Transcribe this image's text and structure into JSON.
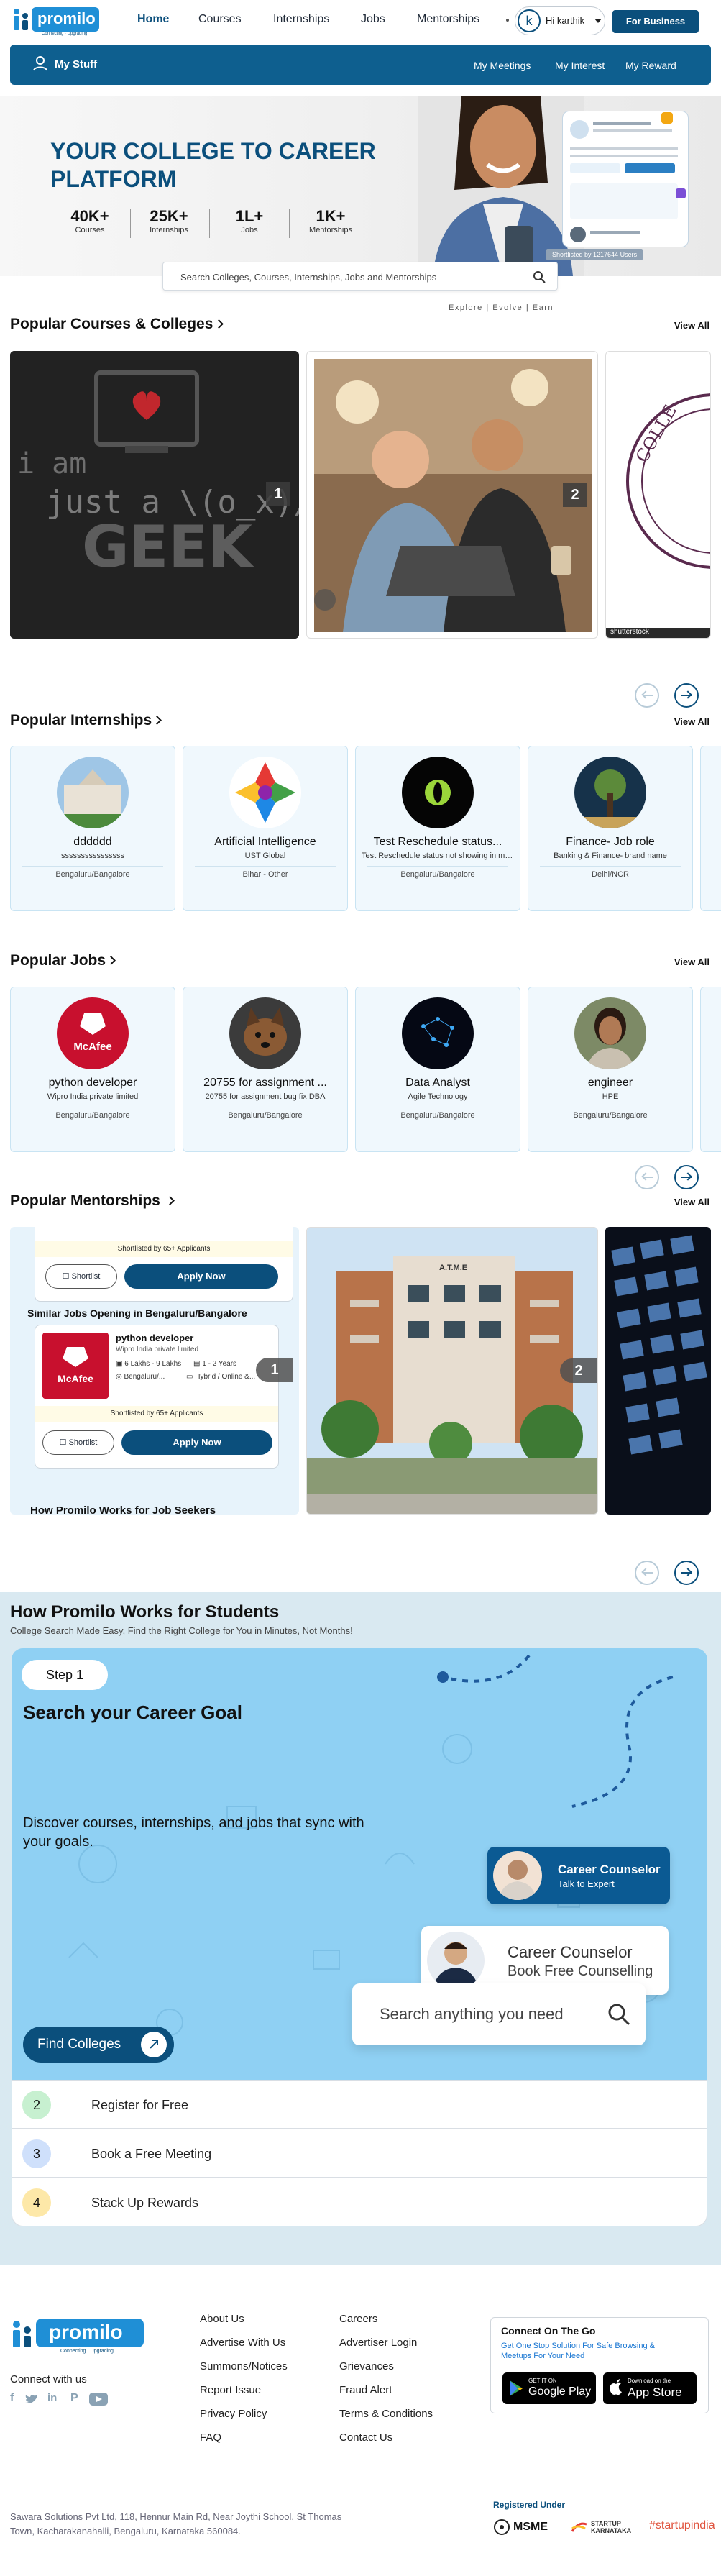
{
  "header": {
    "logo_text": "promilo",
    "logo_tagline": "Connecting · Upgrading",
    "nav": [
      "Home",
      "Courses",
      "Internships",
      "Jobs",
      "Mentorships"
    ],
    "avatar_letter": "k",
    "greeting": "Hi karthik",
    "cta": "For Business"
  },
  "subnav": {
    "title": "My Stuff",
    "links": [
      "My Meetings",
      "My Interest",
      "My Reward"
    ]
  },
  "hero": {
    "headline_1": "YOUR COLLEGE TO CAREER",
    "headline_2": "PLATFORM",
    "stats": [
      {
        "value": "40K+",
        "label": "Courses"
      },
      {
        "value": "25K+",
        "label": "Internships"
      },
      {
        "value": "1L+",
        "label": "Jobs"
      },
      {
        "value": "1K+",
        "label": "Mentorships"
      }
    ],
    "search_placeholder": "Search Colleges, Courses, Internships, Jobs and Mentorships",
    "tagline": "Explore | Evolve | Earn",
    "shortlisted": "Shortlisted by 1217644 Users"
  },
  "courses": {
    "title": "Popular Courses & Colleges",
    "view_all": "View All",
    "slides": [
      {
        "num": "1",
        "art": "i am just a \\(o_x)/ GEEK"
      },
      {
        "num": "2"
      }
    ],
    "peek_caption": "shutterstock"
  },
  "internships": {
    "title": "Popular Internships",
    "view_all": "View All",
    "items": [
      {
        "title": "dddddd",
        "sub": "ssssssssssssssss",
        "loc": "Bengaluru/Bangalore"
      },
      {
        "title": "Artificial Intelligence",
        "sub": "UST Global",
        "loc": "Bihar - Other"
      },
      {
        "title": "Test Reschedule status...",
        "sub": "Test Reschedule status not showing in my...",
        "loc": "Bengaluru/Bangalore"
      },
      {
        "title": "Finance- Job role",
        "sub": "Banking & Finance- brand name",
        "loc": "Delhi/NCR"
      }
    ]
  },
  "jobs": {
    "title": "Popular Jobs",
    "view_all": "View All",
    "items": [
      {
        "title": "python developer",
        "sub": "Wipro India private limited",
        "loc": "Bengaluru/Bangalore",
        "logo": "McAfee"
      },
      {
        "title": "20755 for assignment ...",
        "sub": "20755 for assignment bug fix DBA",
        "loc": "Bengaluru/Bangalore"
      },
      {
        "title": "Data Analyst",
        "sub": "Agile Technology",
        "loc": "Bengaluru/Bangalore"
      },
      {
        "title": "engineer",
        "sub": "HPE",
        "loc": "Bengaluru/Bangalore"
      }
    ]
  },
  "mentorships": {
    "title": "Popular Mentorships",
    "view_all": "View All",
    "shortlisted_1": "Shortlisted by 65+ Applicants",
    "shortlist_btn": "Shortlist",
    "apply_btn": "Apply Now",
    "similar": "Similar Jobs Opening in Bengaluru/Bangalore",
    "job_title": "python developer",
    "job_company": "Wipro India private limited",
    "job_salary": "6 Lakhs - 9 Lakhs",
    "job_exp": "1 - 2 Years",
    "job_loc": "Bengaluru/...",
    "job_mode": "Hybrid / Online &...",
    "shortlisted_2": "Shortlisted by 65+ Applicants",
    "footer_text": "How Promilo Works for Job Seekers",
    "slide_nums": [
      "1",
      "2"
    ],
    "building_sign": "A.T.M.E"
  },
  "how": {
    "title": "How Promilo Works for Students",
    "subtitle": "College Search Made Easy, Find the Right College for You in Minutes, Not Months!",
    "step1_badge": "Step 1",
    "step1_heading": "Search your Career Goal",
    "step1_text": "Discover courses, internships, and jobs that sync with your goals.",
    "counselor_1": "Career Counselor",
    "counselor_1_sub": "Talk to Expert",
    "counselor_2": "Career Counselor",
    "counselor_2_sub": "Book Free Counselling",
    "search_placeholder": "Search anything you need",
    "find_btn": "Find Colleges",
    "steps": [
      {
        "num": "2",
        "label": "Register for Free",
        "color": "#c7f0d0"
      },
      {
        "num": "3",
        "label": "Book a Free Meeting",
        "color": "#cfe0fb"
      },
      {
        "num": "4",
        "label": "Stack Up Rewards",
        "color": "#fde8a8"
      }
    ]
  },
  "footer": {
    "connect": "Connect with us",
    "col1": [
      "About Us",
      "Advertise With Us",
      "Summons/Notices",
      "Report Issue",
      "Privacy Policy",
      "FAQ"
    ],
    "col2": [
      "Careers",
      "Advertiser Login",
      "Grievances",
      "Fraud Alert",
      "Terms & Conditions",
      "Contact Us"
    ],
    "app_title": "Connect On The Go",
    "app_sub": "Get One Stop Solution For Safe Browsing & Meetups For Your Need",
    "gp_small": "GET IT ON",
    "gp": "Google Play",
    "as_small": "Download on the",
    "as": "App Store",
    "address": "Sawara Solutions Pvt Ltd, 118, Hennur Main Rd, Near Joythi School, St Thomas Town, Kacharakanahalli, Bengaluru, Karnataka 560084.",
    "registered": "Registered Under",
    "reg_1": "MSME",
    "reg_2": "STARTUP KARNATAKA",
    "reg_3": "#startupindia"
  },
  "colors": {
    "brand": "#0b4f7c",
    "accent": "#1976d2",
    "subnav": "#0e5f8f"
  }
}
